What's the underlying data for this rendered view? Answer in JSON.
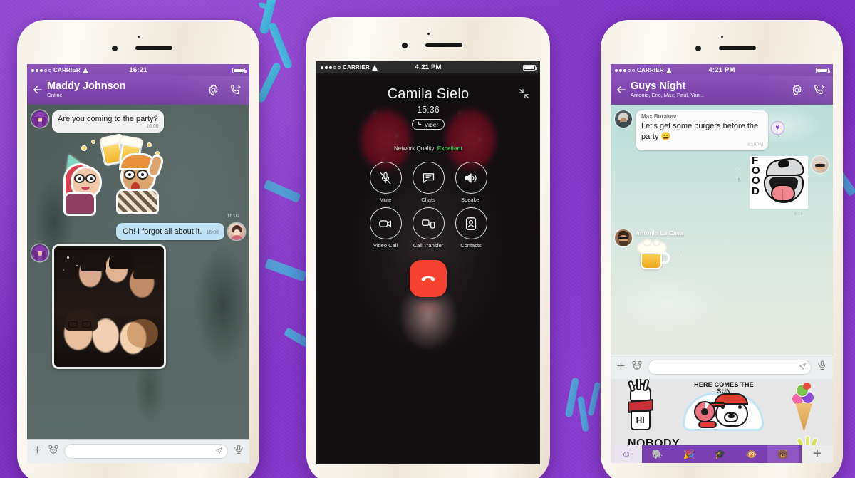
{
  "background": {
    "name": "viber-promo-background",
    "color": "#8134c8",
    "ribbon_color": "#3fc0dd"
  },
  "phones": [
    {
      "id": "phone-chat-1on1",
      "status_bar": {
        "carrier": "CARRIER",
        "time": "16:21",
        "signal_dots": 5,
        "signal_filled": 3,
        "wifi_icon": "wifi-icon",
        "battery_icon": "battery-icon"
      },
      "navbar": {
        "back_icon": "back-arrow-icon",
        "title": "Maddy Johnson",
        "subtitle": "Online",
        "settings_icon": "gear-icon",
        "call_icon": "phone-call-icon"
      },
      "messages": [
        {
          "type": "text",
          "direction": "in",
          "avatar_name": "avatar-maddy",
          "text": "Are you coming to the party?",
          "time": "16:00"
        },
        {
          "type": "sticker",
          "direction": "in",
          "sticker_name": "cheers-beer-sticker",
          "time": "16:01"
        },
        {
          "type": "text",
          "direction": "out",
          "avatar_name": "avatar-self",
          "text": "Oh! I forgot all about it.",
          "time": "16:08"
        },
        {
          "type": "photo",
          "direction": "in",
          "avatar_name": "avatar-maddy",
          "photo_name": "group-selfie-photo"
        }
      ],
      "input_bar": {
        "plus_icon": "plus-icon",
        "sticker_icon": "bear-sticker-icon",
        "placeholder": "",
        "value": "",
        "send_icon": "send-arrow-icon",
        "mic_icon": "microphone-icon"
      }
    },
    {
      "id": "phone-active-call",
      "status_bar": {
        "carrier": "CARRIER",
        "time": "4:21 PM",
        "signal_dots": 5,
        "signal_filled": 3,
        "wifi_icon": "wifi-icon",
        "battery_icon": "battery-icon"
      },
      "call": {
        "contact_name": "Camila Sielo",
        "duration": "15:36",
        "badge_label": "Viber",
        "badge_icon": "viber-phone-icon",
        "minimize_icon": "minimize-icon",
        "network_quality_label": "Network Quality:",
        "network_quality_value": "Excellent",
        "network_quality_color": "#2fc455",
        "end_call_icon": "end-call-icon",
        "end_call_color": "#f5412f",
        "controls": [
          {
            "label": "Mute",
            "icon": "mic-muted-icon"
          },
          {
            "label": "Chats",
            "icon": "chat-bubble-icon"
          },
          {
            "label": "Speaker",
            "icon": "speaker-icon"
          },
          {
            "label": "Video Call",
            "icon": "video-camera-icon"
          },
          {
            "label": "Call Transfer",
            "icon": "call-transfer-icon"
          },
          {
            "label": "Contacts",
            "icon": "contacts-person-icon"
          }
        ]
      }
    },
    {
      "id": "phone-group-chat",
      "status_bar": {
        "carrier": "CARRIER",
        "time": "4:21 PM",
        "signal_dots": 5,
        "signal_filled": 3,
        "wifi_icon": "wifi-icon",
        "battery_icon": "battery-icon"
      },
      "navbar": {
        "back_icon": "back-arrow-icon",
        "title": "Guys Night",
        "subtitle": "Antonio, Eric, Max, Paul, Yan...",
        "settings_icon": "gear-icon",
        "call_icon": "phone-call-icon"
      },
      "messages": [
        {
          "type": "text",
          "direction": "in",
          "avatar_name": "avatar-max",
          "sender": "Max Burakev",
          "text": "Let's get some burgers before the party 😄",
          "time": "4:19PM",
          "reaction_icon": "purple-heart-icon",
          "reaction_count": "5"
        },
        {
          "type": "sticker",
          "direction": "out",
          "sticker_name": "food-mouth-sticker",
          "sticker_text": "FOOD",
          "avatar_name": "avatar-sender-right",
          "time": "4:14",
          "reaction_icon": "heart-outline-icon",
          "reaction_count": "5"
        },
        {
          "type": "sticker",
          "direction": "in",
          "avatar_name": "avatar-antonio",
          "sender": "Antonio La Cava",
          "sticker_name": "beer-mug-sticker",
          "reaction_icon": "heart-outline-icon"
        }
      ],
      "input_bar": {
        "plus_icon": "plus-icon",
        "sticker_icon": "bear-sticker-icon",
        "placeholder": "",
        "value": "",
        "send_icon": "send-arrow-icon",
        "mic_icon": "microphone-icon"
      },
      "sticker_drawer": {
        "stickers": [
          {
            "name": "hi-hand-sticker",
            "text": "HI"
          },
          {
            "name": "here-comes-the-sun-bear-sticker",
            "text": "HERE COMES THE SUN"
          },
          {
            "name": "ice-cream-cone-sticker",
            "text": ""
          },
          {
            "name": "nobody-text-sticker",
            "text": "NOBODY"
          },
          {
            "name": "pineapple-sticker",
            "text": ""
          }
        ],
        "tabs": [
          {
            "name": "emoji-tab",
            "icon": "smiley-icon",
            "state": "active"
          },
          {
            "name": "elephant-pack-tab",
            "icon": "elephant-icon",
            "state": "normal"
          },
          {
            "name": "party-pack-tab",
            "icon": "party-icon",
            "state": "normal"
          },
          {
            "name": "graduate-pack-tab",
            "icon": "graduation-cap-icon",
            "state": "normal"
          },
          {
            "name": "monkey-pack-tab",
            "icon": "monkey-icon",
            "state": "normal"
          },
          {
            "name": "bear-pack-tab",
            "icon": "bear-icon",
            "state": "selected"
          }
        ],
        "add_pack_label": "+"
      }
    }
  ]
}
